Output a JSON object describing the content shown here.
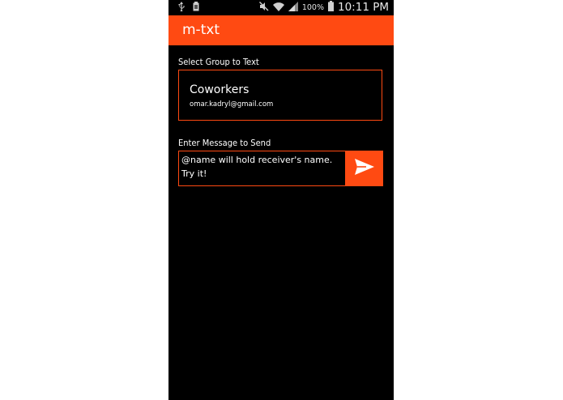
{
  "status_bar": {
    "battery_percent": "100%",
    "time": "10:11 PM",
    "icons": [
      "usb-icon",
      "sim-icon",
      "mute-icon",
      "wifi-icon",
      "signal-icon",
      "battery-icon"
    ]
  },
  "app_bar": {
    "title": "m-txt"
  },
  "group_section": {
    "label": "Select Group to Text",
    "selected_group": {
      "name": "Coworkers",
      "email": "omar.kadryl@gmail.com"
    }
  },
  "message_section": {
    "label": "Enter Message to Send",
    "message_value": "@name will hold receiver's name. Try it!"
  },
  "colors": {
    "accent": "#ff4a12",
    "background": "#000000",
    "text": "#ffffff"
  }
}
